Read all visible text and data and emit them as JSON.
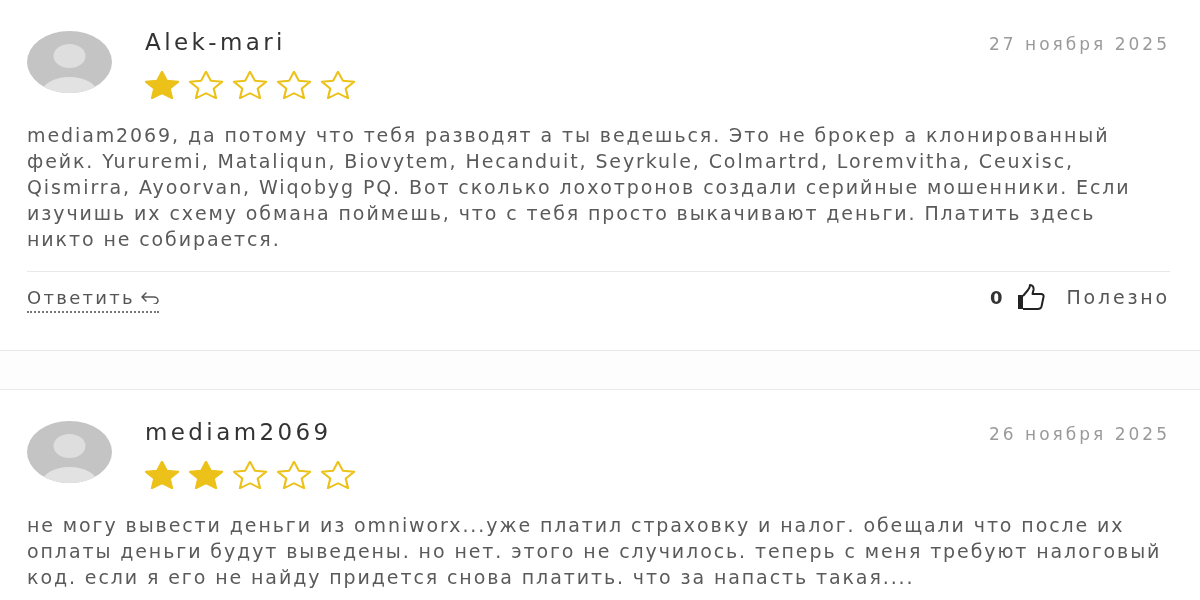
{
  "reviews": [
    {
      "author": "Alek-mari",
      "date": "27 ноября 2025",
      "stars": 1,
      "text": "mediam2069, да потому что тебя разводят а ты ведешься. Это не брокер а клонированный фейк. Yururemi, Mataliqun, Biovytem, Hecanduit, Seyrkule, Colmartrd, Loremvitha, Ceuxisc, Qismirra, Ayoorvan, Wiqobyg PQ. Вот сколько лохотронов создали серийные мошенники. Если изучишь их схему обмана поймешь, что с тебя просто выкачивают деньги. Платить здесь никто не собирается.",
      "footer": {
        "reply_label": "Ответить",
        "likes": "0",
        "helpful_label": "Полезно"
      }
    },
    {
      "author": "mediam2069",
      "date": "26 ноября 2025",
      "stars": 2,
      "text": "не могу вывести деньги из omniworx...уже платил страховку и налог. обещали что после их оплаты деньги будут выведены. но нет. этого не случилось. теперь с меня требуют налоговый код. если я его не найду придется снова платить. что за напасть такая...."
    }
  ]
}
